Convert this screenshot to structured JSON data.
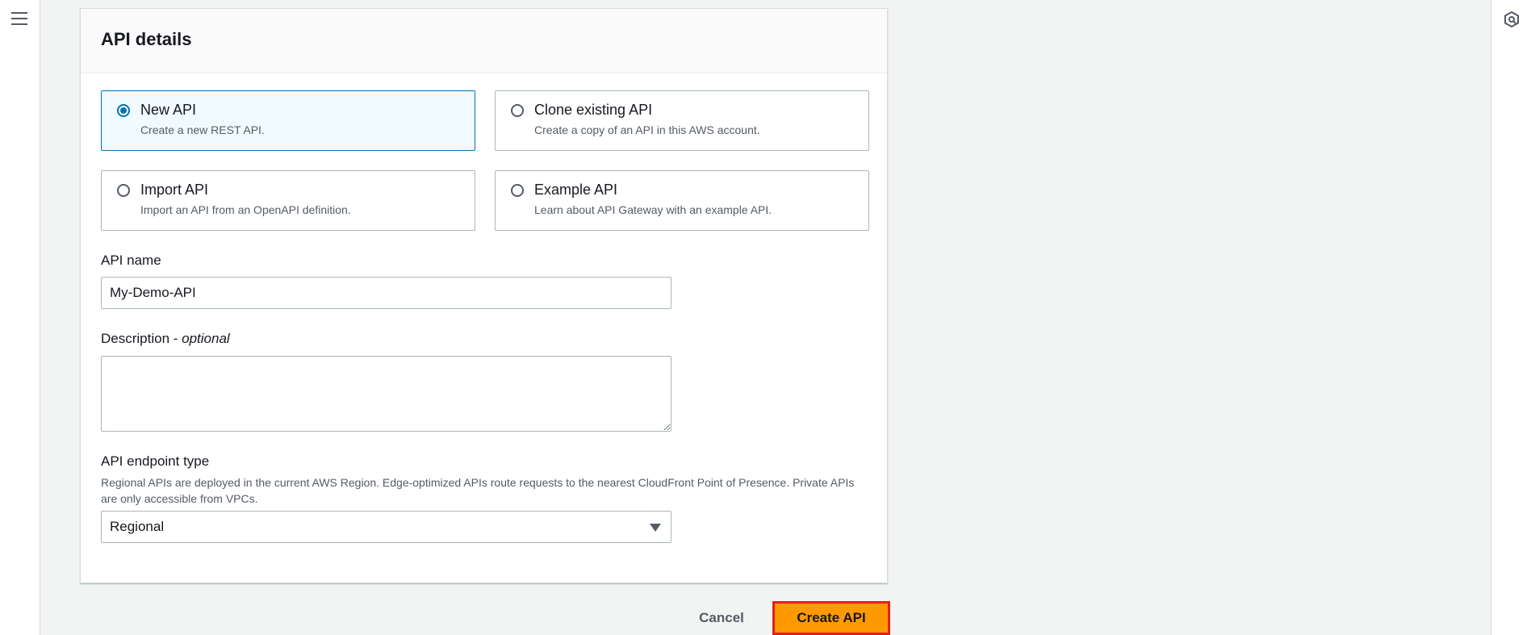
{
  "nav": {
    "menu_icon": "hamburger-menu-icon",
    "tools_icon": "tools-panel-icon"
  },
  "panel": {
    "title": "API details"
  },
  "options": [
    {
      "title": "New API",
      "description": "Create a new REST API.",
      "selected": true
    },
    {
      "title": "Clone existing API",
      "description": "Create a copy of an API in this AWS account.",
      "selected": false
    },
    {
      "title": "Import API",
      "description": "Import an API from an OpenAPI definition.",
      "selected": false
    },
    {
      "title": "Example API",
      "description": "Learn about API Gateway with an example API.",
      "selected": false
    }
  ],
  "api_name": {
    "label": "API name",
    "value": "My-Demo-API"
  },
  "description": {
    "label": "Description - ",
    "optional": "optional",
    "value": ""
  },
  "endpoint": {
    "label": "API endpoint type",
    "help": "Regional APIs are deployed in the current AWS Region. Edge-optimized APIs route requests to the nearest CloudFront Point of Presence. Private APIs are only accessible from VPCs.",
    "selected": "Regional"
  },
  "actions": {
    "cancel": "Cancel",
    "create": "Create API"
  },
  "colors": {
    "primary": "#ff9900",
    "selected_border": "#0073bb",
    "highlight": "#e02020"
  }
}
